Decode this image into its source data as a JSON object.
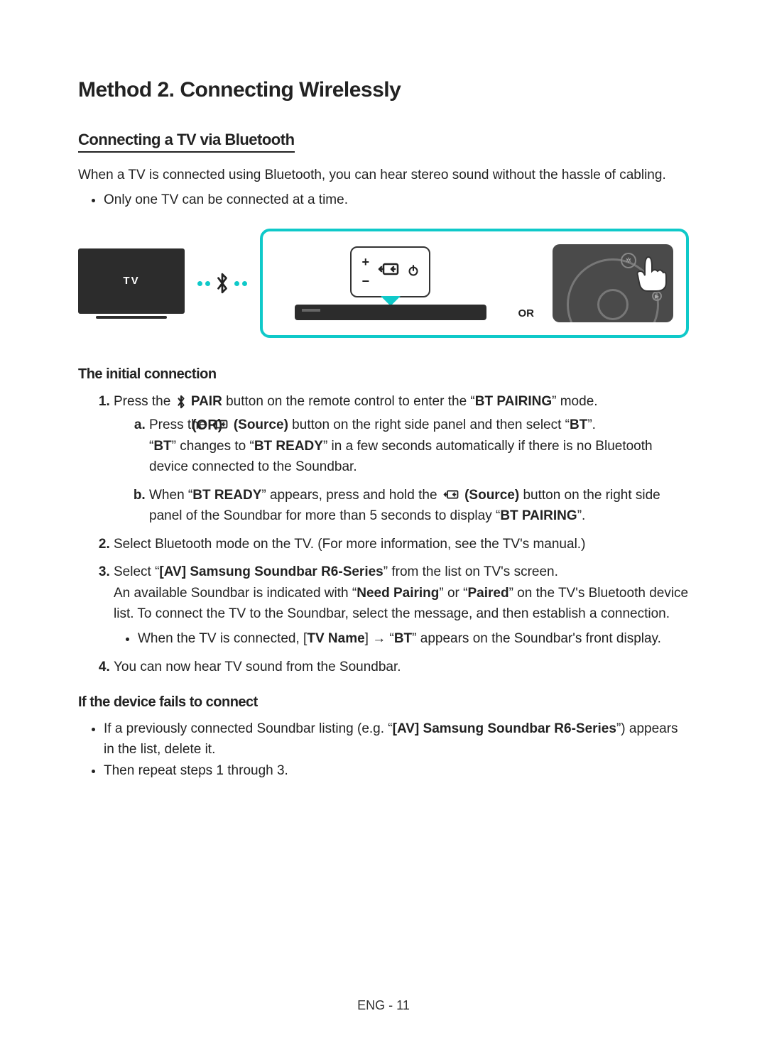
{
  "title": "Method 2. Connecting Wirelessly",
  "section": {
    "heading": "Connecting a TV via Bluetooth",
    "intro": "When a TV is connected using Bluetooth, you can hear stereo sound without the hassle of cabling.",
    "bullet": "Only one TV can be connected at a time."
  },
  "diagram": {
    "tv_label": "TV",
    "or_label": "OR"
  },
  "initial": {
    "heading": "The initial connection",
    "or_label": "(OR)",
    "step1_a": "Press the ",
    "step1_b": " PAIR",
    "step1_c": " button on the remote control to enter the “",
    "step1_d": "BT PAIRING",
    "step1_e": "” mode.",
    "a_a": "Press the ",
    "a_b": " (Source)",
    "a_c": " button on the right side panel and then select “",
    "a_d": "BT",
    "a_e": "”.",
    "a_line2_a": "“",
    "a_line2_b": "BT",
    "a_line2_c": "” changes to “",
    "a_line2_d": "BT READY",
    "a_line2_e": "” in a few seconds automatically if there is no Bluetooth device connected to the Soundbar.",
    "b_a": "When “",
    "b_b": "BT READY",
    "b_c": "” appears, press and hold the ",
    "b_d": " (Source)",
    "b_e": " button on the right side panel of the Soundbar for more than 5 seconds to display “",
    "b_f": "BT PAIRING",
    "b_g": "”.",
    "step2": "Select Bluetooth mode on the TV. (For more information, see the TV's manual.)",
    "step3_a": "Select “",
    "step3_b": "[AV] Samsung Soundbar R6-Series",
    "step3_c": "” from the list on TV's screen.",
    "step3_line2_a": "An available Soundbar is indicated with “",
    "step3_line2_b": "Need Pairing",
    "step3_line2_c": "” or “",
    "step3_line2_d": "Paired",
    "step3_line2_e": "” on the TV's Bluetooth device list. To connect the TV to the Soundbar, select the message, and then establish a connection.",
    "step3_bullet_a": "When the TV is connected, [",
    "step3_bullet_b": "TV Name",
    "step3_bullet_c": "] → “",
    "step3_bullet_d": "BT",
    "step3_bullet_e": "” appears on the Soundbar's front display.",
    "step4": "You can now hear TV sound from the Soundbar."
  },
  "fail": {
    "heading": "If the device fails to connect",
    "b1_a": "If a previously connected Soundbar listing (e.g. “",
    "b1_b": "[AV] Samsung Soundbar R6-Series",
    "b1_c": "”) appears in the list, delete it.",
    "b2": "Then repeat steps 1 through 3."
  },
  "footer": "ENG - 11"
}
